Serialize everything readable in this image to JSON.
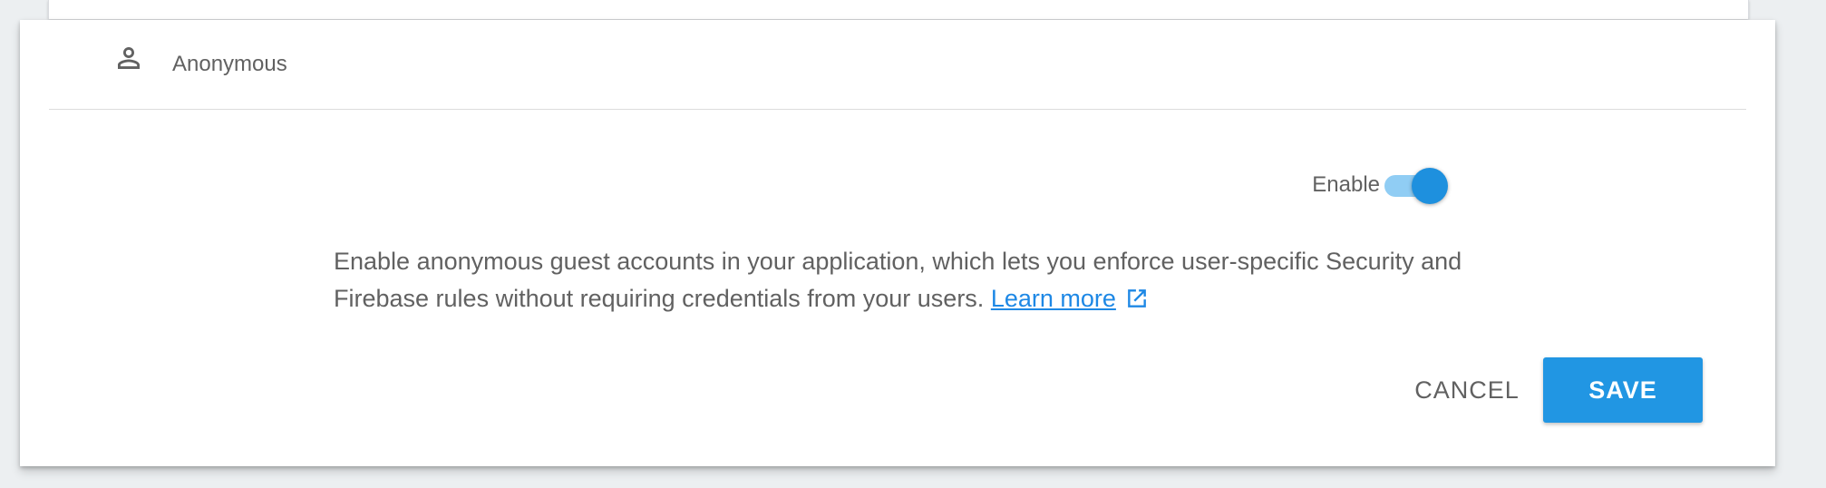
{
  "provider": {
    "name": "Anonymous",
    "icon": "person-icon"
  },
  "toggle": {
    "label": "Enable",
    "state": "on",
    "accent_color": "#1e90de",
    "track_color": "#90cdf4"
  },
  "description": {
    "text": "Enable anonymous guest accounts in your application, which lets you enforce user-specific Security and Firebase rules without requiring credentials from your users.",
    "link_label": "Learn more",
    "link_icon": "open-in-new-icon"
  },
  "actions": {
    "cancel_label": "CANCEL",
    "save_label": "SAVE",
    "primary_color": "#2196e3"
  }
}
